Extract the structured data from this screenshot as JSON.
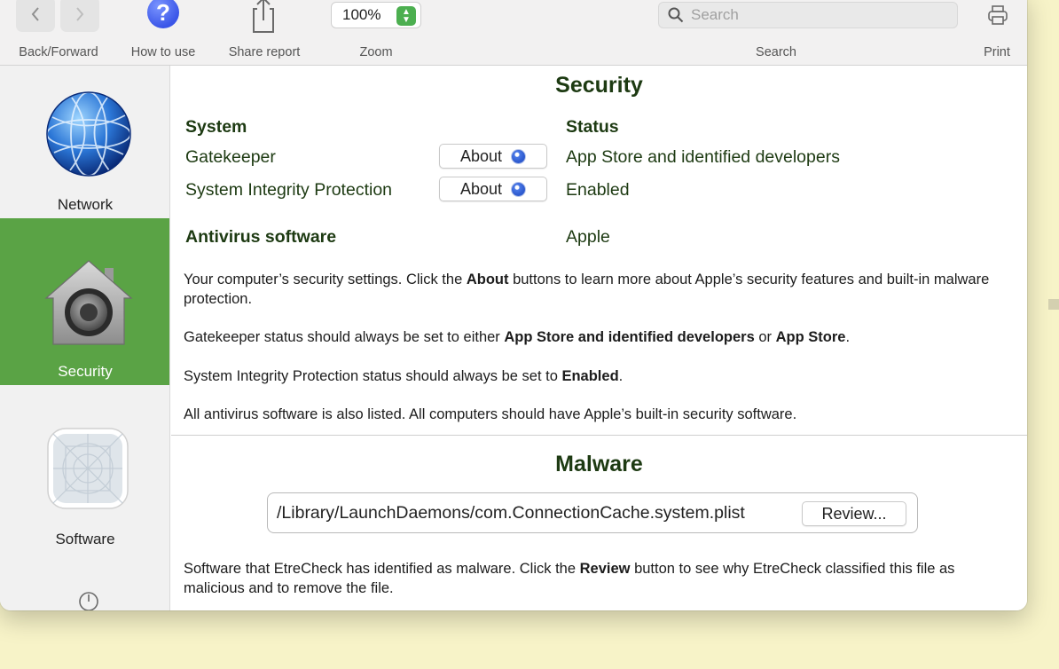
{
  "toolbar": {
    "back_icon": "chevron-left",
    "forward_icon": "chevron-right",
    "back_forward_label": "Back/Forward",
    "help_glyph": "?",
    "how_to_use_label": "How to use",
    "share_label": "Share report",
    "zoom_value": "100%",
    "zoom_label": "Zoom",
    "search_placeholder": "Search",
    "search_label": "Search",
    "print_label": "Print"
  },
  "sidebar": {
    "items": [
      {
        "label": "Network",
        "icon": "globe-icon"
      },
      {
        "label": "Security",
        "icon": "house-lock-icon",
        "active": true
      },
      {
        "label": "Software",
        "icon": "app-icon"
      }
    ]
  },
  "security": {
    "title": "Security",
    "col_system": "System",
    "col_status": "Status",
    "rows": [
      {
        "name": "Gatekeeper",
        "button": "About",
        "status": "App Store and identified developers"
      },
      {
        "name": "System Integrity Protection",
        "button": "About",
        "status": "Enabled"
      }
    ],
    "antivirus_label": "Antivirus software",
    "antivirus_value": "Apple",
    "p1_a": "Your computer’s security settings. Click the ",
    "p1_b": "About",
    "p1_c": " buttons to learn more about Apple’s security features and built-in malware protection.",
    "p2_a": "Gatekeeper status should always be set to either ",
    "p2_b": "App Store and identified developers",
    "p2_c": " or ",
    "p2_d": "App Store",
    "p2_e": ".",
    "p3_a": "System Integrity Protection status should always be set to ",
    "p3_b": "Enabled",
    "p3_c": ".",
    "p4": "All antivirus software is also listed. All computers should have Apple’s built-in security software."
  },
  "malware": {
    "title": "Malware",
    "path": "/Library/LaunchDaemons/com.ConnectionCache.system.plist",
    "review_label": "Review...",
    "p_a": "Software that EtreCheck has identified as malware. Click the ",
    "p_b": "Review",
    "p_c": " button to see why EtreCheck classified this file as malicious and to remove the file."
  },
  "colors": {
    "accent_green": "#5aa345",
    "heading_text": "#1d3a12",
    "background": "#f7f3c8"
  }
}
